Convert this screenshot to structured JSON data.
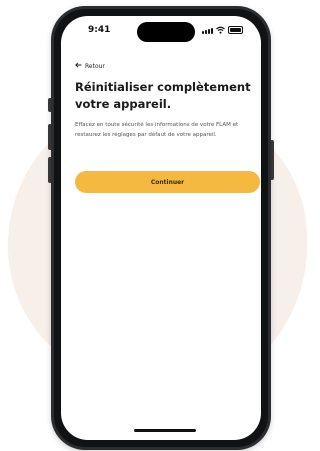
{
  "status_bar": {
    "time": "9:41"
  },
  "nav": {
    "back_label": "Retour"
  },
  "content": {
    "title": "Réinitialiser complètement votre appareil.",
    "description": "Effacez en toute sécurité les informations de votre FLAM et restaurez les réglages par défaut de votre appareil.",
    "continue_label": "Continuer"
  },
  "colors": {
    "accent": "#f5b941",
    "background_blob": "#f6efea",
    "phone_frame": "#2b2d31"
  },
  "icons": [
    "back-arrow-icon",
    "signal-icon",
    "wifi-icon",
    "battery-icon"
  ]
}
